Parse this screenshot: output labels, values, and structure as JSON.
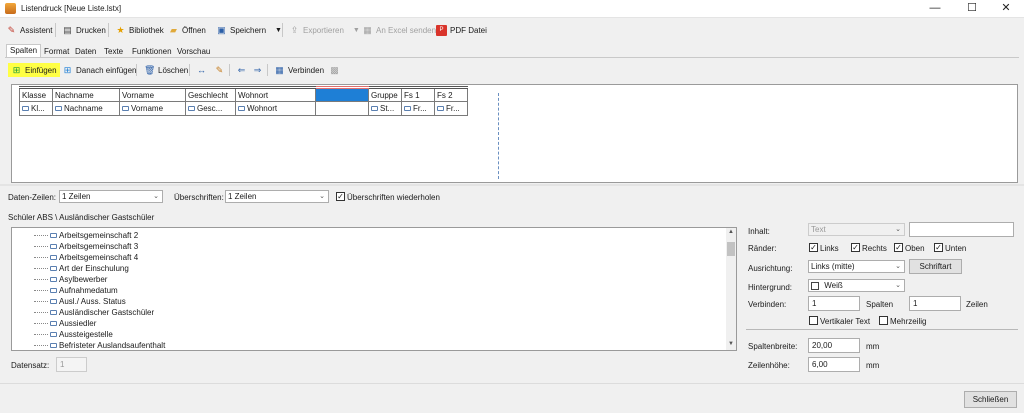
{
  "window": {
    "title": "Listendruck [Neue Liste.lstx]",
    "minimize": "—",
    "maximize": "☐",
    "close": "✕"
  },
  "toolbar": {
    "assistent": "Assistent",
    "drucken": "Drucken",
    "bibliothek": "Bibliothek",
    "oeffnen": "Öffnen",
    "speichern": "Speichern",
    "exportieren": "Exportieren",
    "excel": "An Excel senden",
    "pdf": "PDF Datei"
  },
  "tabs": [
    "Spalten",
    "Format",
    "Daten",
    "Texte",
    "Funktionen",
    "Vorschau"
  ],
  "column_toolbar": {
    "einfuegen": "Einfügen",
    "danach_einfuegen": "Danach einfügen",
    "loeschen": "Löschen",
    "verbinden": "Verbinden"
  },
  "grid": {
    "headers": [
      "Klasse",
      "Nachname",
      "Vorname",
      "Geschlecht",
      "Wohnort",
      "",
      "Gruppe",
      "Fs 1",
      "Fs 2"
    ],
    "fields": [
      "Kl...",
      "Nachname",
      "Vorname",
      "Gesc...",
      "Wohnort",
      "",
      "St...",
      "Fr...",
      "Fr..."
    ]
  },
  "options": {
    "daten_zeilen_label": "Daten-Zeilen:",
    "daten_zeilen_value": "1 Zeilen",
    "ueberschriften_label": "Überschriften:",
    "ueberschriften_value": "1 Zeilen",
    "wiederholen_label": "Überschriften wiederholen",
    "wiederholen_checked": true
  },
  "breadcrumb": "Schüler ABS \\ Ausländischer Gastschüler",
  "field_list": [
    "Arbeitsgemeinschaft 2",
    "Arbeitsgemeinschaft 3",
    "Arbeitsgemeinschaft 4",
    "Art der Einschulung",
    "Asylbewerber",
    "Aufnahmedatum",
    "Ausl./ Auss. Status",
    "Ausländischer Gastschüler",
    "Aussiedler",
    "Aussteigestelle",
    "Befristeter Auslandsaufenthalt"
  ],
  "datensatz": {
    "label": "Datensatz:",
    "value": "1"
  },
  "properties": {
    "inhalt_label": "Inhalt:",
    "inhalt_value": "Text",
    "inhalt_text": "",
    "raender_label": "Ränder:",
    "raender": [
      {
        "label": "Links",
        "checked": true
      },
      {
        "label": "Rechts",
        "checked": true
      },
      {
        "label": "Oben",
        "checked": true
      },
      {
        "label": "Unten",
        "checked": true
      }
    ],
    "ausrichtung_label": "Ausrichtung:",
    "ausrichtung_value": "Links (mitte)",
    "schriftart_button": "Schriftart",
    "hintergrund_label": "Hintergrund:",
    "hintergrund_value": "Weiß",
    "verbinden_label": "Verbinden:",
    "spalten_value": "1",
    "spalten_label": "Spalten",
    "zeilen_value": "1",
    "zeilen_label": "Zeilen",
    "vertikaler_text": "Vertikaler Text",
    "mehrzeilig": "Mehrzeilig",
    "spaltenbreite_label": "Spaltenbreite:",
    "spaltenbreite_value": "20,00",
    "zeilenhoehe_label": "Zeilenhöhe:",
    "zeilenhoehe_value": "6,00",
    "unit": "mm"
  },
  "footer": {
    "schliessen": "Schließen"
  }
}
